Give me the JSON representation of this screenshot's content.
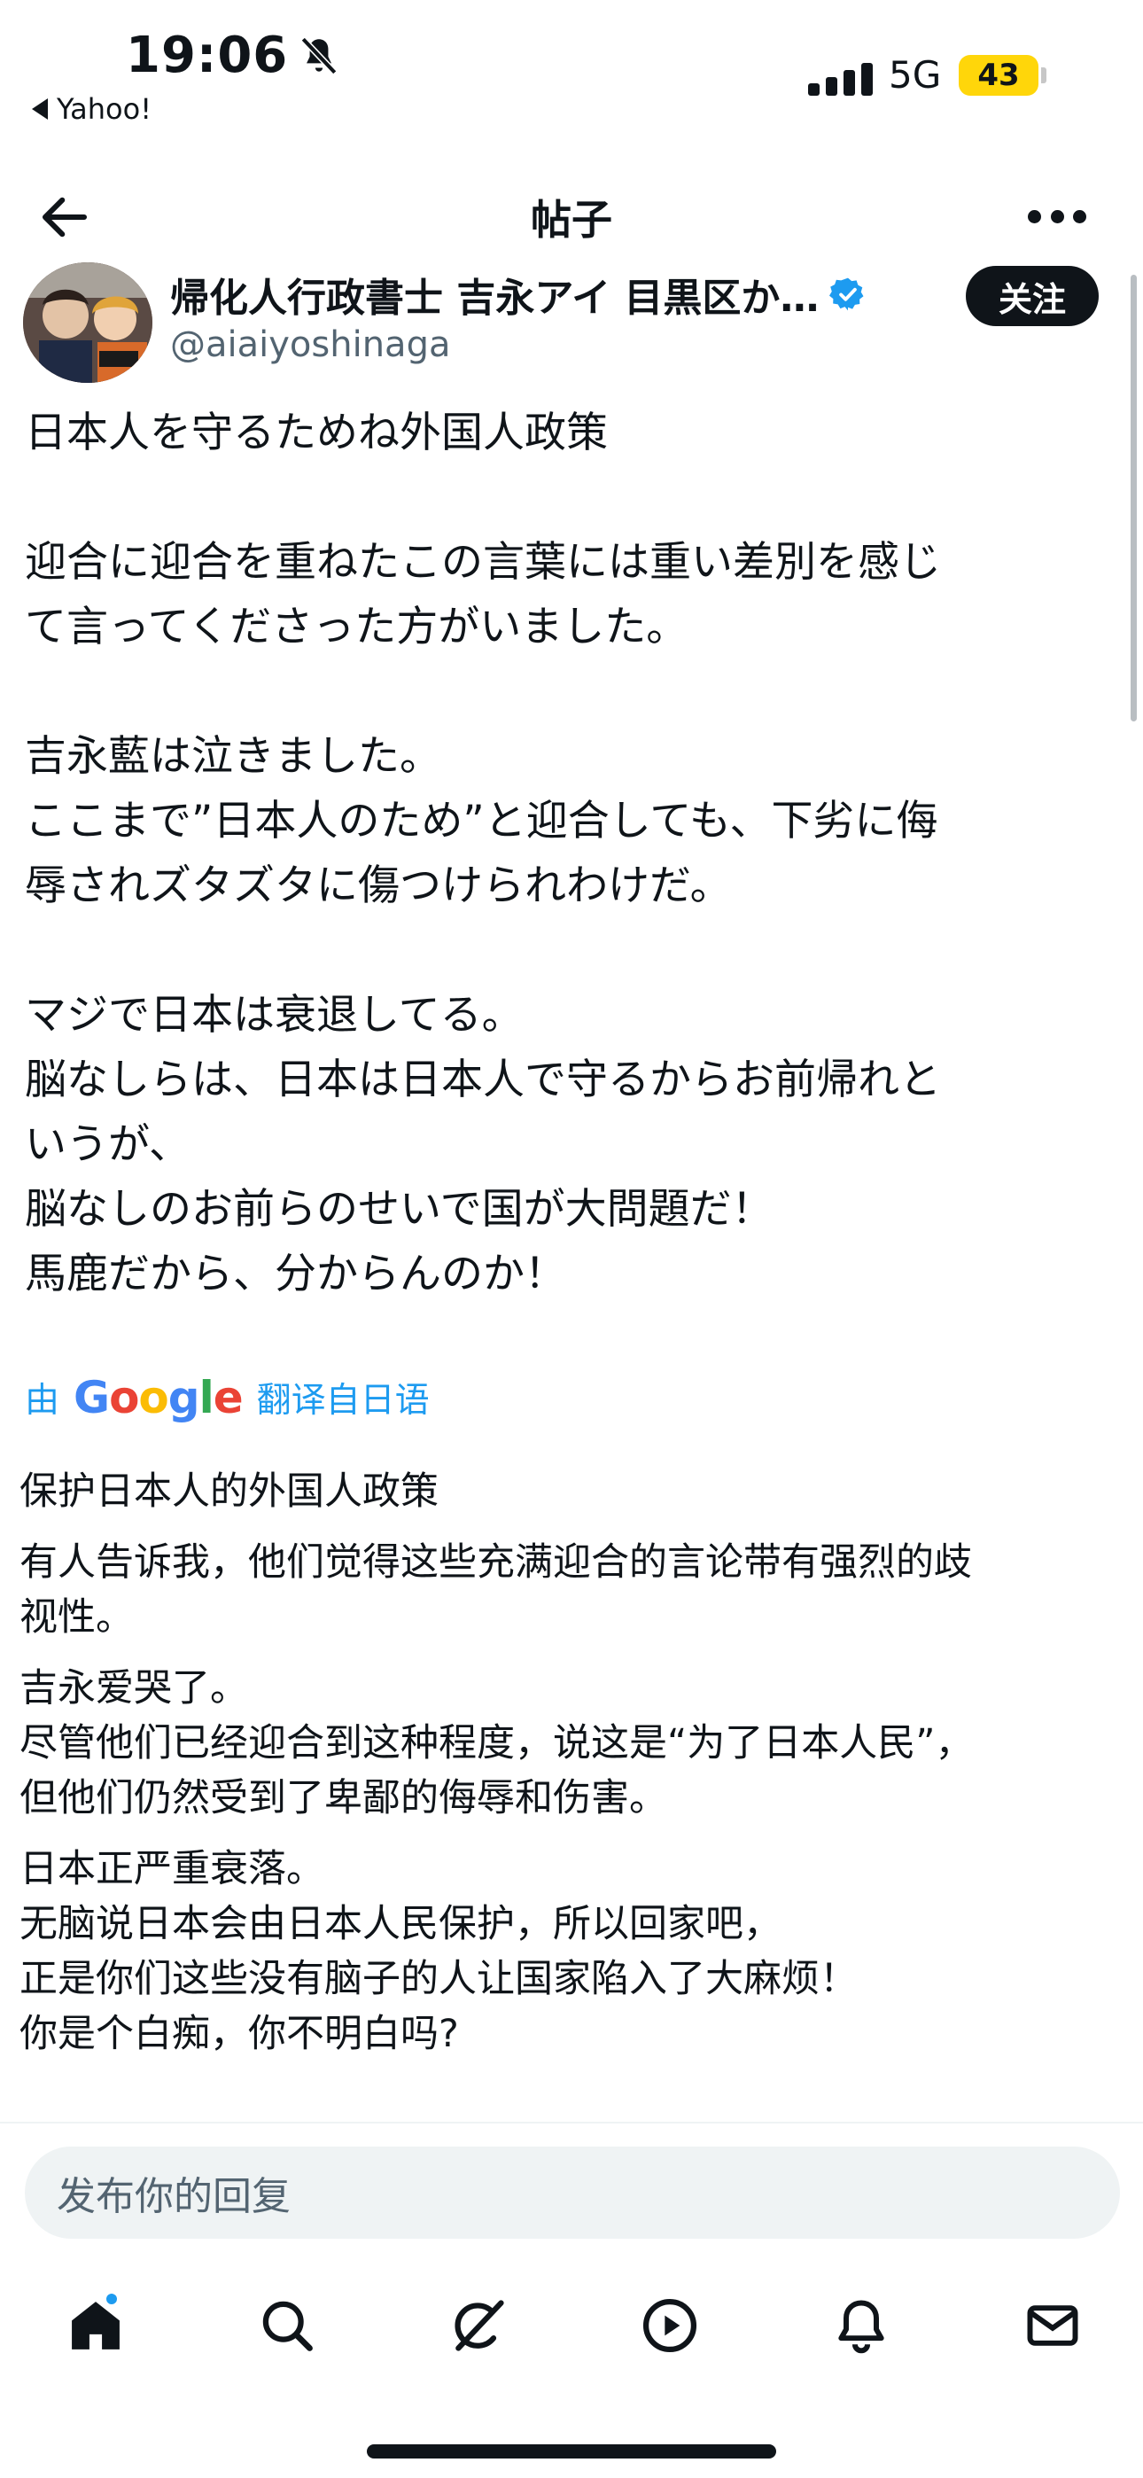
{
  "status_bar": {
    "time": "19:06",
    "back_app": "Yahoo!",
    "network": "5G",
    "battery": "43"
  },
  "header": {
    "title": "帖子"
  },
  "author": {
    "name": "帰化人行政書士 吉永アイ 目黒区か…",
    "handle": "@aiaiyoshinaga",
    "follow_label": "关注"
  },
  "post": {
    "paragraphs": [
      [
        "日本人を守るためね外国人政策"
      ],
      [
        "迎合に迎合を重ねたこの言葉には重い差別を感じ",
        "て言ってくださった方がいました。"
      ],
      [
        "吉永藍は泣きました。",
        "ここまで”日本人のため”と迎合しても、下劣に侮",
        "辱されズタズタに傷つけられわけだ。"
      ],
      [
        "マジで日本は衰退してる。",
        "脳なしらは、日本は日本人で守るからお前帰れと",
        "いうが、",
        "脳なしのお前らのせいで国が大問題だ！",
        "馬鹿だから、分からんのか！"
      ]
    ]
  },
  "translation": {
    "prefix": "由",
    "brand": "Google",
    "suffix": "翻译自日语",
    "paragraphs": [
      [
        "保护日本人的外国人政策"
      ],
      [
        "有人告诉我，他们觉得这些充满迎合的言论带有强烈的歧",
        "视性。"
      ],
      [
        "吉永爱哭了。",
        "尽管他们已经迎合到这种程度，说这是“为了日本人民”，",
        "但他们仍然受到了卑鄙的侮辱和伤害。"
      ],
      [
        "日本正严重衰落。",
        "无脑说日本会由日本人民保护，所以回家吧，",
        "正是你们这些没有脑子的人让国家陷入了大麻烦！",
        "你是个白痴，你不明白吗?"
      ]
    ]
  },
  "reply": {
    "placeholder": "发布你的回复"
  },
  "tabs": [
    "home-icon",
    "search-icon",
    "grok-icon",
    "video-icon",
    "notifications-icon",
    "messages-icon"
  ],
  "colors": {
    "accent": "#1d9bf0",
    "battery": "#ffd60a",
    "text": "#0f1419",
    "muted": "#536471"
  }
}
